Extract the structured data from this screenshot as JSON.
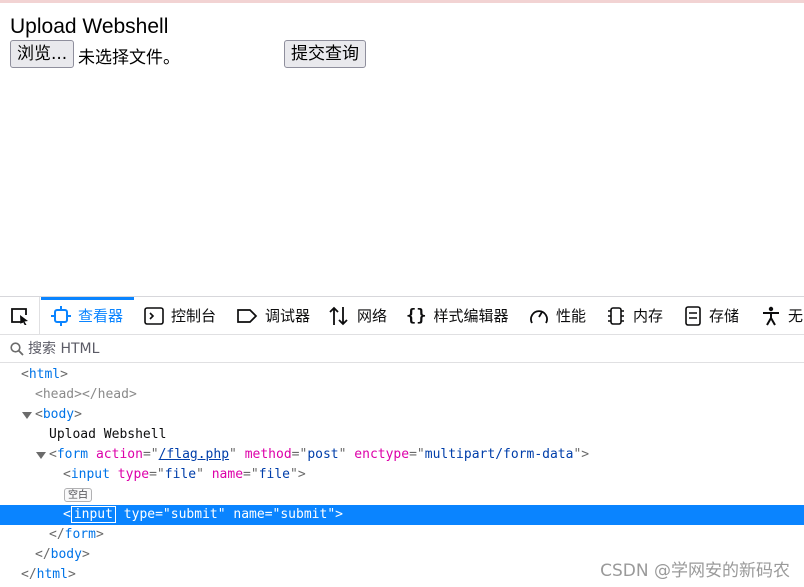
{
  "page": {
    "title": "Upload Webshell",
    "browse_label": "浏览...",
    "file_status": "未选择文件。",
    "submit_label": "提交查询"
  },
  "devtools": {
    "tabs": [
      {
        "label": "查看器",
        "icon": "inspector-icon",
        "active": true
      },
      {
        "label": "控制台",
        "icon": "console-icon"
      },
      {
        "label": "调试器",
        "icon": "debugger-icon"
      },
      {
        "label": "网络",
        "icon": "network-icon"
      },
      {
        "label": "样式编辑器",
        "icon": "style-editor-icon"
      },
      {
        "label": "性能",
        "icon": "performance-icon"
      },
      {
        "label": "内存",
        "icon": "memory-icon"
      },
      {
        "label": "存储",
        "icon": "storage-icon"
      },
      {
        "label": "无",
        "icon": "accessibility-icon"
      }
    ],
    "search_placeholder": "搜索 HTML",
    "tree": {
      "html_open": "html",
      "head": "head",
      "body_open": "body",
      "text_node": "Upload Webshell",
      "form_tag": "form",
      "form_attrs": [
        {
          "name": "action",
          "value": "/flag.php"
        },
        {
          "name": "method",
          "value": "post"
        },
        {
          "name": "enctype",
          "value": "multipart/form-data"
        }
      ],
      "input1_tag": "input",
      "input1_attrs": [
        {
          "name": "type",
          "value": "file"
        },
        {
          "name": "name",
          "value": "file"
        }
      ],
      "whitespace_badge": "空白",
      "input2_tag": "input",
      "input2_attrs": [
        {
          "name": "type",
          "value": "submit"
        },
        {
          "name": "name",
          "value": "submit"
        }
      ],
      "form_close": "form",
      "body_close": "body",
      "html_close": "html"
    }
  },
  "watermark": "CSDN @学网安的新码农"
}
